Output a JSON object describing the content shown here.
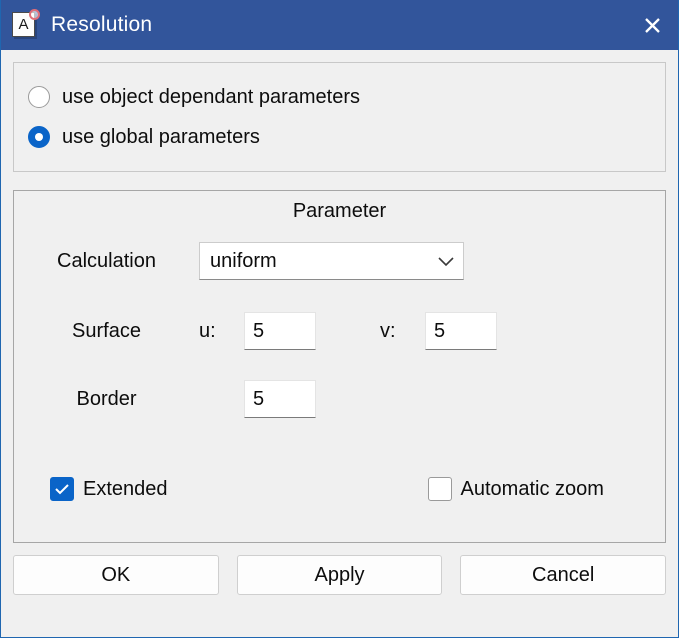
{
  "window": {
    "title": "Resolution",
    "icon": "document-a-icon",
    "icon_letter": "A",
    "close_label": "×",
    "titlebar_color": "#32559b",
    "accent_color": "#0a64c8",
    "background_color": "#f0f0f0"
  },
  "mode_group": {
    "options": [
      {
        "label": "use object dependant parameters",
        "selected": false
      },
      {
        "label": "use global parameters",
        "selected": true
      }
    ]
  },
  "parameter_group": {
    "title": "Parameter",
    "calculation": {
      "label": "Calculation",
      "value": "uniform",
      "arrow_icon": "chevron-down-icon"
    },
    "surface": {
      "label": "Surface",
      "u_label": "u:",
      "u_value": "5",
      "v_label": "v:",
      "v_value": "5"
    },
    "border": {
      "label": "Border",
      "value": "5"
    },
    "checkboxes": [
      {
        "label": "Extended",
        "checked": true
      },
      {
        "label": "Automatic zoom",
        "checked": false
      }
    ]
  },
  "buttons": [
    {
      "label": "OK"
    },
    {
      "label": "Apply"
    },
    {
      "label": "Cancel"
    }
  ]
}
